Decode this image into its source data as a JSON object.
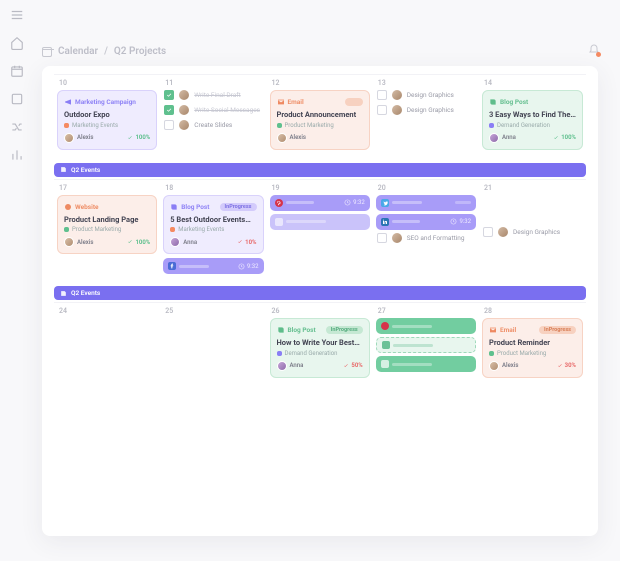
{
  "breadcrumb": {
    "root": "Calendar",
    "page": "Q2 Projects"
  },
  "span_bar_label": "Q2 Events",
  "week1": {
    "days": [
      "10",
      "11",
      "12",
      "13",
      "14"
    ],
    "cards": {
      "d10": {
        "type": "Marketing Campaign",
        "title": "Outdoor Expo",
        "cat": "Marketing Events",
        "assignee": "Alexis",
        "progress": "100%"
      },
      "d12": {
        "type": "Email",
        "title": "Product Announcement",
        "cat": "Product Marketing",
        "assignee": "Alexis"
      },
      "d14": {
        "type": "Blog Post",
        "title": "3 Easy Ways to Find The…",
        "cat": "Demand Generation",
        "assignee": "Anna",
        "progress": "100%"
      }
    },
    "tasks_d11": [
      {
        "label": "Write Final Draft",
        "done": true
      },
      {
        "label": "Write Social Messages",
        "done": true
      },
      {
        "label": "Create Slides",
        "done": false
      }
    ],
    "tasks_d13": [
      {
        "label": "Design Graphics",
        "done": false
      },
      {
        "label": "Design Graphics",
        "done": false
      }
    ]
  },
  "week2": {
    "days": [
      "17",
      "18",
      "19",
      "20",
      "21"
    ],
    "cards": {
      "d17": {
        "type": "Website",
        "title": "Product Landing Page",
        "cat": "Product Marketing",
        "assignee": "Alexis",
        "progress": "100%"
      },
      "d18": {
        "type": "Blog Post",
        "pill": "InProgress",
        "title": "5 Best Outdoor Events…",
        "cat": "Marketing Events",
        "assignee": "Anna",
        "progress": "10%"
      }
    },
    "tiles": {
      "d18_fb": {
        "time": "9:32"
      },
      "d19_pin": {
        "time": "9:32"
      },
      "d19_tw": {
        "skel": true
      },
      "d20_tw": {
        "skel": true
      },
      "d20_li": {
        "time": "9:32"
      }
    },
    "tasks_d20": [
      {
        "label": "SEO and Formatting",
        "done": false
      }
    ],
    "tasks_d21": [
      {
        "label": "Design Graphics",
        "done": false
      }
    ]
  },
  "week3": {
    "days": [
      "24",
      "25",
      "26",
      "27",
      "28"
    ],
    "cards": {
      "d26": {
        "type": "Blog Post",
        "pill": "InProgress",
        "title": "How to Write Your Best…",
        "cat": "Demand Generation",
        "assignee": "Anna",
        "progress": "50%"
      },
      "d28": {
        "type": "Email",
        "pill": "InProgress",
        "title": "Product Reminder",
        "cat": "Product Marketing",
        "assignee": "Alexis",
        "progress": "30%"
      }
    }
  }
}
